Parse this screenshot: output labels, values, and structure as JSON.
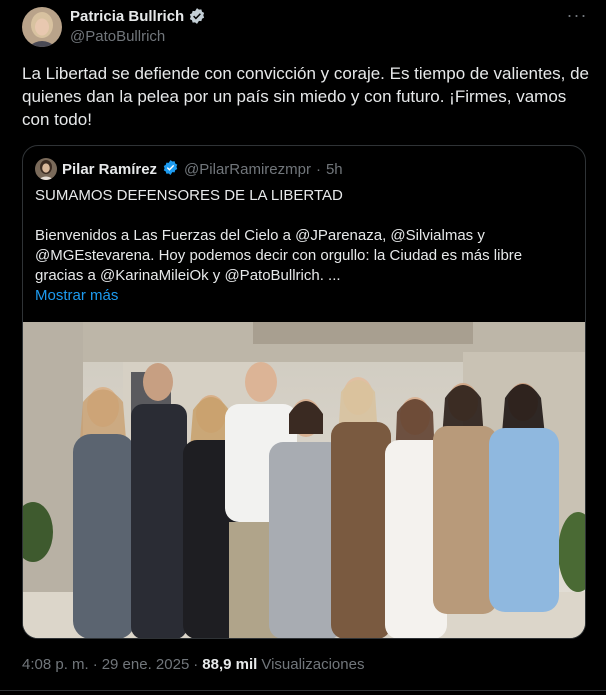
{
  "author": {
    "name": "Patricia Bullrich",
    "handle": "@PatoBullrich",
    "verified_icon": "verified-badge-icon"
  },
  "tweet": {
    "text": "La Libertad se defiende con convicción y coraje. Es tiempo de valientes, de quienes dan la pelea por un país sin miedo y con futuro. ¡Firmes, vamos con todo!",
    "more_icon": "more-options-icon"
  },
  "quoted": {
    "name": "Pilar Ramírez",
    "handle": "@PilarRamirezmpr",
    "separator": "·",
    "time": "5h",
    "headline": "SUMAMOS DEFENSORES DE LA LIBERTAD",
    "body": "Bienvenidos a Las Fuerzas del Cielo a @JParenaza, @Silvialmas y @MGEstevarena. Hoy podemos decir con orgullo: la Ciudad es más libre gracias a @KarinaMileiOk y @PatoBullrich. ...",
    "show_more": "Mostrar más"
  },
  "meta": {
    "time": "4:08 p. m.",
    "separator": "·",
    "date": "29 ene. 2025",
    "separator2": "·",
    "views_count": "88,9 mil",
    "views_label": "Visualizaciones"
  },
  "colors": {
    "background": "#000000",
    "text": "#e7e9ea",
    "muted": "#71767b",
    "link": "#1d9bf0",
    "border": "#2f3336"
  }
}
